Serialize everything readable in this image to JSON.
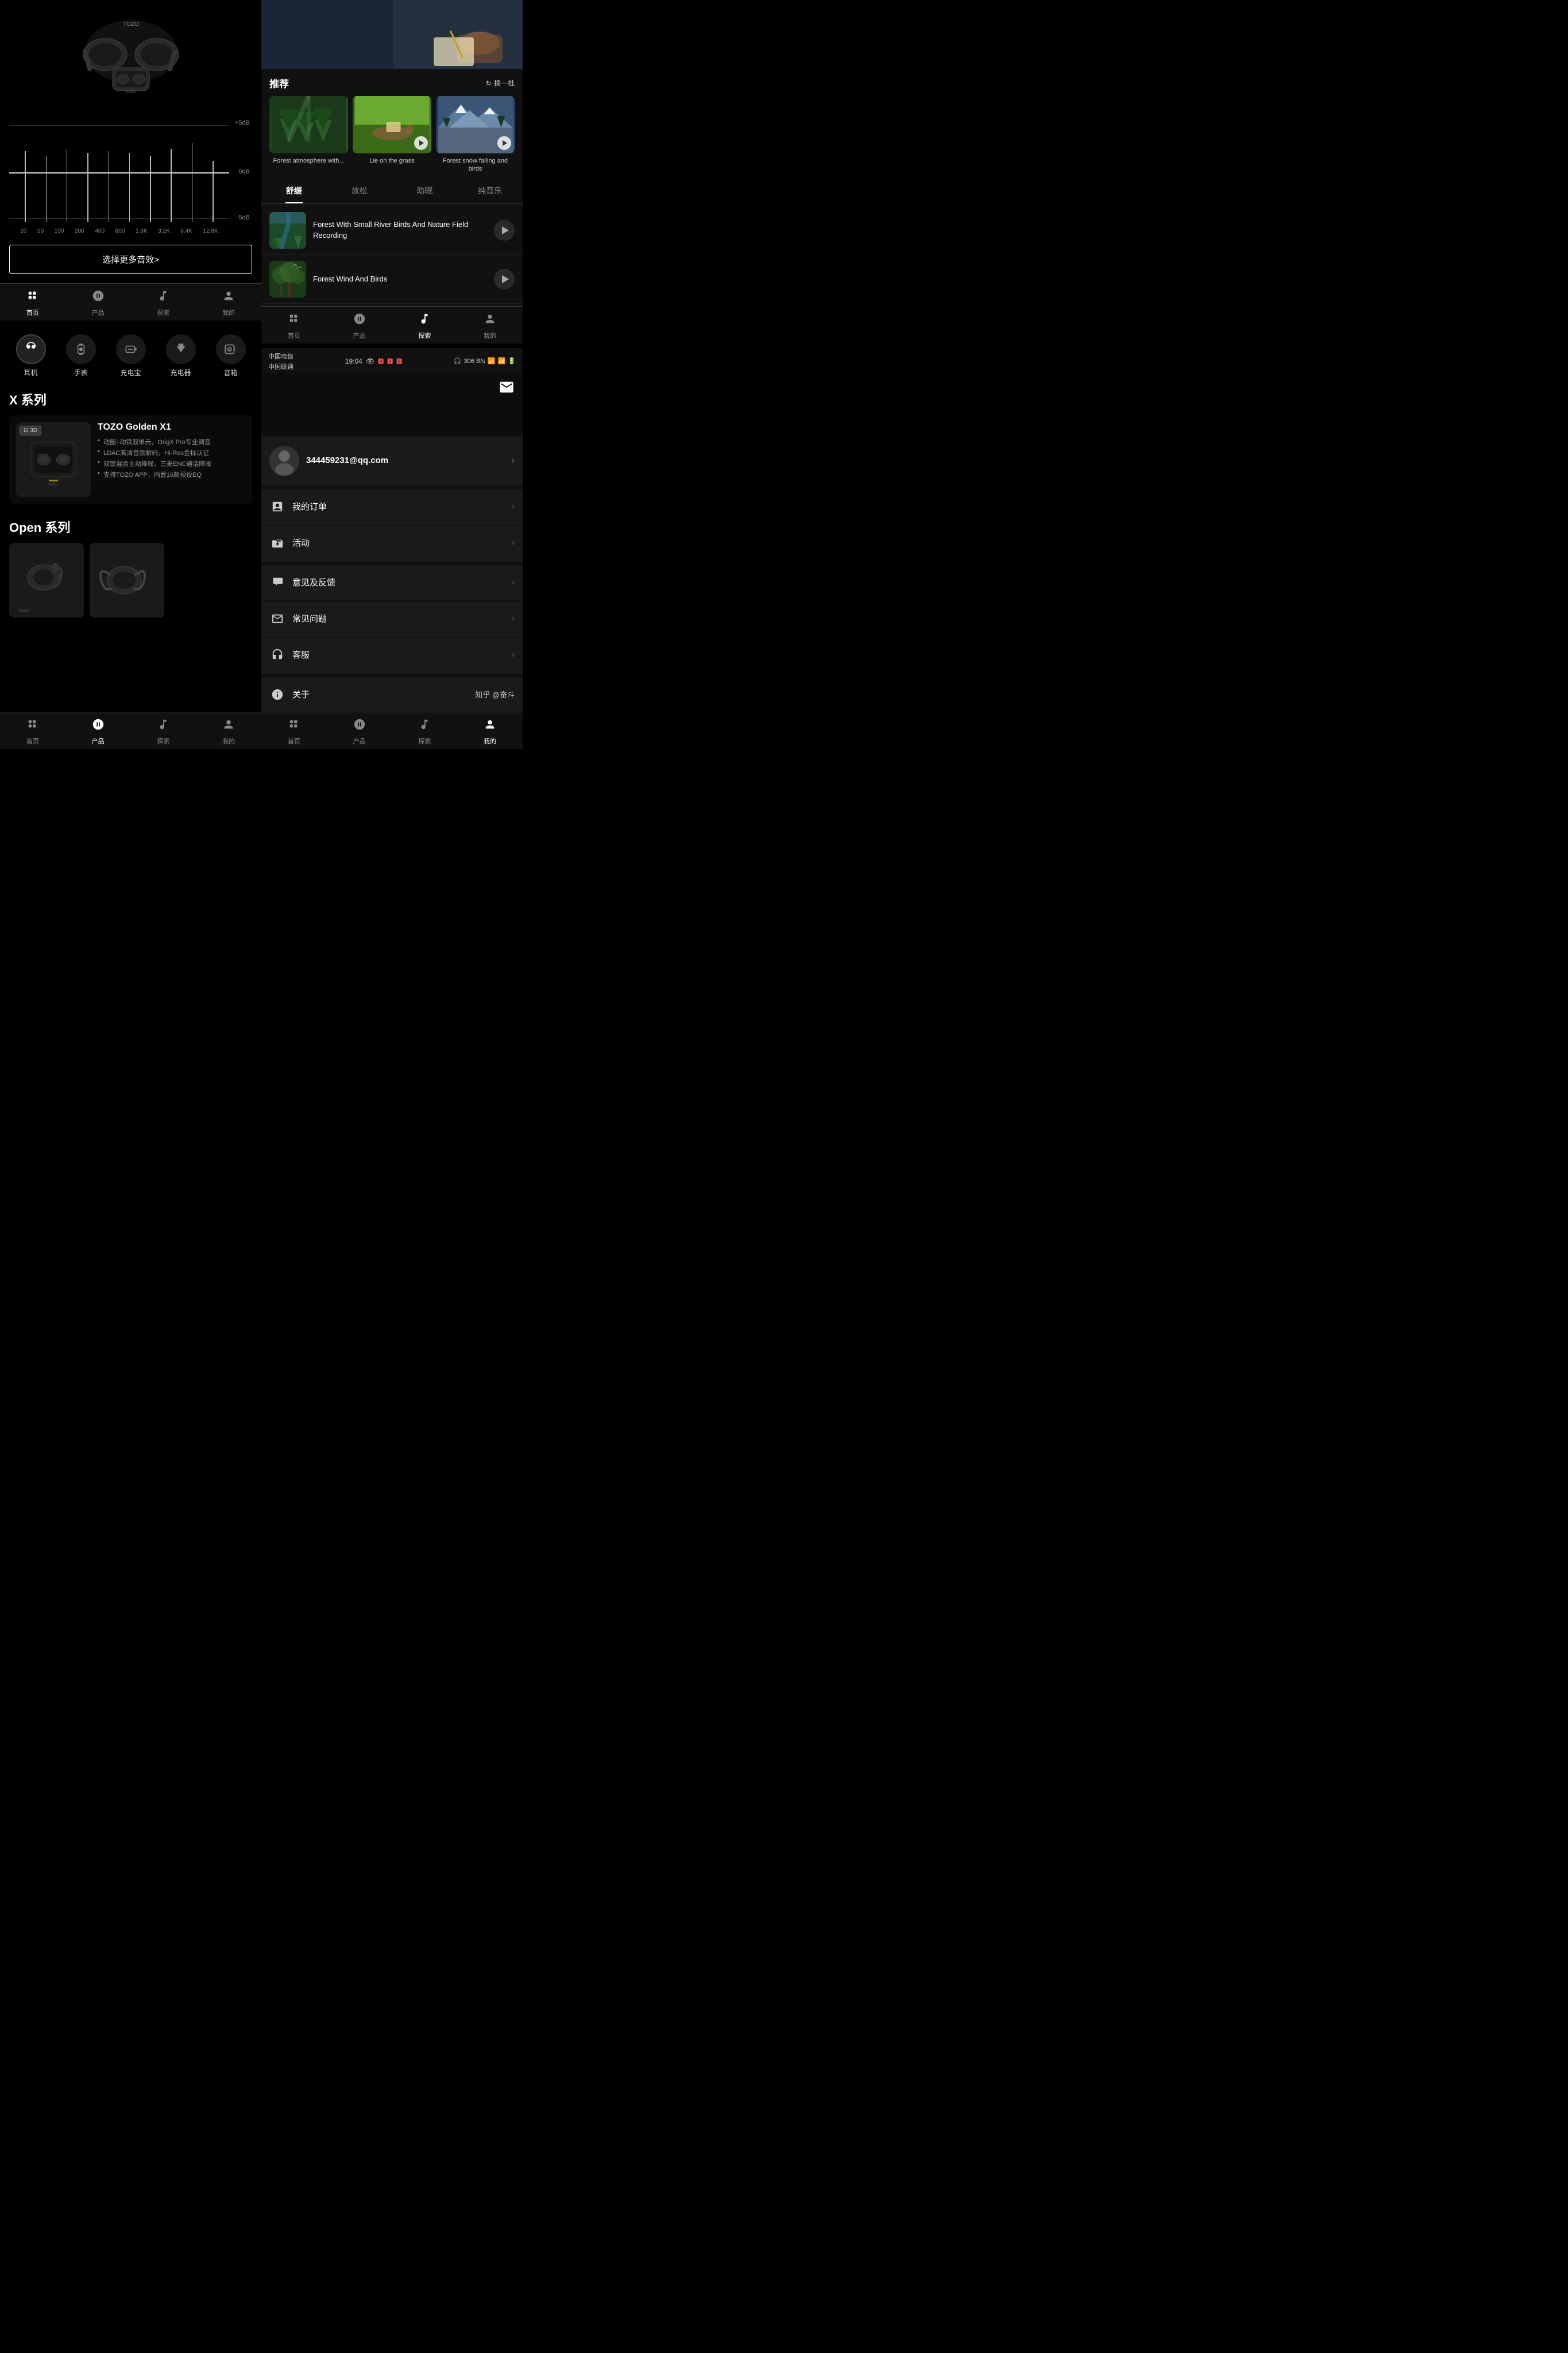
{
  "left": {
    "eq": {
      "labels_db": [
        "+5dB",
        "0dB",
        "-5dB"
      ],
      "freq_labels": [
        "20",
        "50",
        "100",
        "200",
        "400",
        "800",
        "1.6K",
        "3.2K",
        "6.4K",
        "12.8K"
      ],
      "button": "选择更多音效>"
    },
    "nav": {
      "items": [
        {
          "label": "首页",
          "icon": "⊞",
          "active": true
        },
        {
          "label": "产品",
          "icon": "👤",
          "active": false
        },
        {
          "label": "探索",
          "icon": "♪",
          "active": false
        },
        {
          "label": "我的",
          "icon": "👤",
          "active": false
        }
      ]
    },
    "product": {
      "categories": [
        {
          "label": "耳机",
          "active": true
        },
        {
          "label": "手表",
          "active": false
        },
        {
          "label": "充电宝",
          "active": false
        },
        {
          "label": "充电器",
          "active": false
        },
        {
          "label": "音箱",
          "active": false
        }
      ],
      "x_series_title": "X 系列",
      "open_series_title": "Open 系列",
      "product_name": "TOZO Golden X1",
      "product_features": [
        "动圈+动铁双单元，OrigX Pro专业调音",
        "LDAC高清音频解码，Hi-Res金标认证",
        "双馈混合主动降噪，三麦ENC通话降噪",
        "支持TOZO APP，内置16款预设EQ"
      ],
      "badge_3d": "⊡ 3D"
    }
  },
  "right": {
    "recommend": {
      "title": "推荐",
      "refresh_label": "换一批",
      "cards": [
        {
          "title": "Forest atmosphere with...",
          "has_play": false
        },
        {
          "title": "Lie on the grass",
          "has_play": true
        },
        {
          "title": "Forest snow falling and birds",
          "has_play": true
        }
      ]
    },
    "tabs": [
      "舒缓",
      "放松",
      "助眠",
      "纯音乐"
    ],
    "active_tab": 0,
    "sound_items": [
      {
        "title": "Forest With Small River Birds And Nature Field Recording"
      },
      {
        "title": "Forest Wind And Birds"
      }
    ],
    "profile": {
      "email": "344459231@qq.com",
      "menu_items": [
        {
          "icon": "≡",
          "label": "我的订单"
        },
        {
          "icon": "🎁",
          "label": "活动"
        },
        {
          "icon": "📦",
          "label": "意见及反馈"
        },
        {
          "icon": "✉",
          "label": "常见问题"
        },
        {
          "icon": "👤",
          "label": "客服"
        }
      ],
      "about_label": "关于",
      "about_tag": "知乎 @奋斗"
    },
    "status_bar": {
      "carrier1": "中国电信",
      "carrier2": "中国联通",
      "time": "19:04",
      "network_speed": "306 B/s"
    },
    "nav": {
      "items": [
        {
          "label": "首页",
          "active": false
        },
        {
          "label": "产品",
          "active": false
        },
        {
          "label": "探索",
          "active": true
        },
        {
          "label": "我的",
          "active": false
        }
      ]
    }
  }
}
